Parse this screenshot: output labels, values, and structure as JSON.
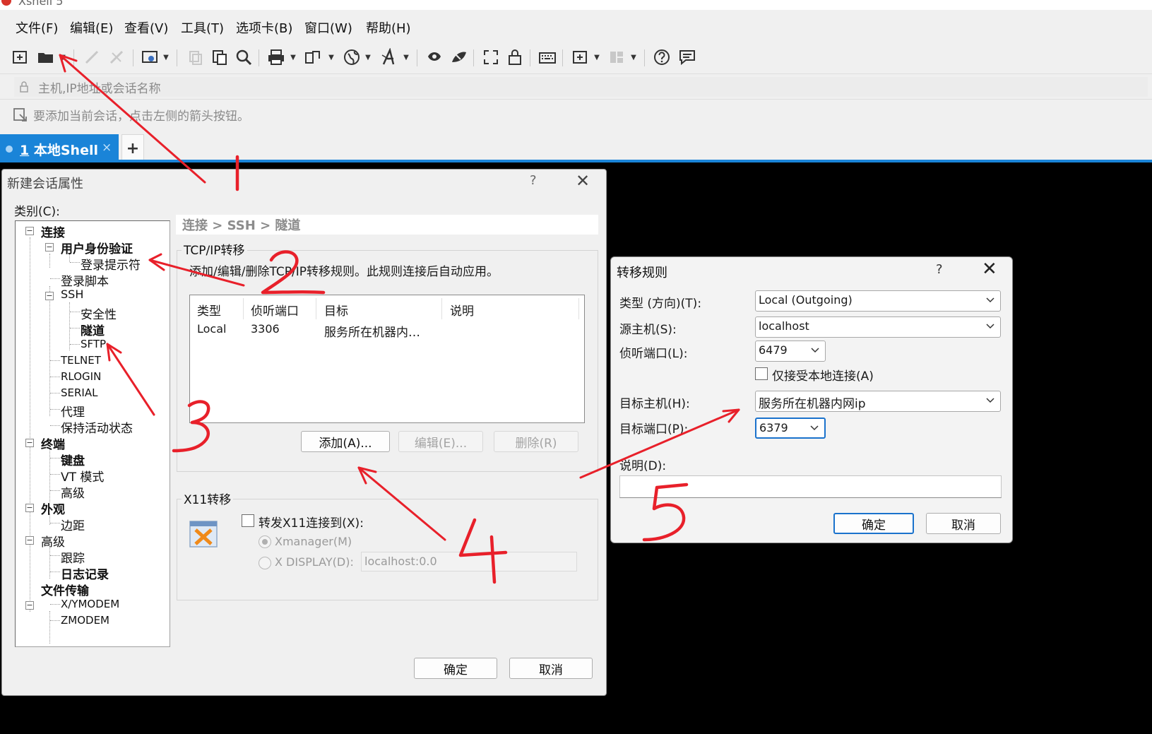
{
  "app": {
    "title": "Xshell 5",
    "menu": [
      "文件(F)",
      "编辑(E)",
      "查看(V)",
      "工具(T)",
      "选项卡(B)",
      "窗口(W)",
      "帮助(H)"
    ],
    "address_placeholder": "主机,IP地址或会话名称",
    "hint_text": "要添加当前会话，点击左侧的箭头按钮。",
    "tab": {
      "index": "1",
      "label": "本地Shell",
      "close": "×",
      "add": "+"
    },
    "accent_color": "#1a84d8"
  },
  "session_dialog": {
    "title": "新建会话属性",
    "help": "?",
    "close": "✕",
    "category_label": "类别(C):",
    "tree": [
      {
        "label": "连接",
        "bold": true
      },
      {
        "label": "用户身份验证",
        "bold": true
      },
      {
        "label": "登录提示符",
        "bold": false
      },
      {
        "label": "登录脚本",
        "bold": false
      },
      {
        "label": "SSH",
        "bold": false
      },
      {
        "label": "安全性",
        "bold": false
      },
      {
        "label": "隧道",
        "bold": true
      },
      {
        "label": "SFTP",
        "bold": false
      },
      {
        "label": "TELNET",
        "bold": false
      },
      {
        "label": "RLOGIN",
        "bold": false
      },
      {
        "label": "SERIAL",
        "bold": false
      },
      {
        "label": "代理",
        "bold": false
      },
      {
        "label": "保持活动状态",
        "bold": false
      },
      {
        "label": "终端",
        "bold": true
      },
      {
        "label": "键盘",
        "bold": true
      },
      {
        "label": "VT 模式",
        "bold": false
      },
      {
        "label": "高级",
        "bold": false
      },
      {
        "label": "外观",
        "bold": true
      },
      {
        "label": "边距",
        "bold": false
      },
      {
        "label": "高级",
        "bold": false
      },
      {
        "label": "跟踪",
        "bold": false
      },
      {
        "label": "日志记录",
        "bold": true
      },
      {
        "label": "文件传输",
        "bold": true
      },
      {
        "label": "X/YMODEM",
        "bold": false
      },
      {
        "label": "ZMODEM",
        "bold": false
      }
    ],
    "breadcrumb": "连接 > SSH > 隧道",
    "tcp_group": {
      "legend": "TCP/IP转移",
      "description": "添加/编辑/删除TCP/IP转移规则。此规则连接后自动应用。",
      "columns": [
        "类型",
        "侦听端口",
        "目标",
        "说明"
      ],
      "rows": [
        {
          "type": "Local",
          "port": "3306",
          "target": "服务所在机器内…",
          "desc": ""
        }
      ],
      "add_button": "添加(A)...",
      "edit_button": "编辑(E)...",
      "delete_button": "删除(R)"
    },
    "x11_group": {
      "legend": "X11转移",
      "forward_label": "转发X11连接到(X):",
      "xmanager_label": "Xmanager(M)",
      "xdisplay_label": "X DISPLAY(D):",
      "xdisplay_value": "localhost:0.0"
    },
    "ok_button": "确定",
    "cancel_button": "取消"
  },
  "rule_dialog": {
    "title": "转移规则",
    "help": "?",
    "close": "✕",
    "type_label": "类型 (方向)(T):",
    "type_value": "Local (Outgoing)",
    "source_label": "源主机(S):",
    "source_value": "localhost",
    "listen_label": "侦听端口(L):",
    "listen_value": "6479",
    "local_only_label": "仅接受本地连接(A)",
    "target_host_label": "目标主机(H):",
    "target_host_value": "服务所在机器内网ip",
    "target_port_label": "目标端口(P):",
    "target_port_value": "6379",
    "desc_label": "说明(D):",
    "desc_value": "",
    "ok_button": "确定",
    "cancel_button": "取消"
  },
  "annotations": {
    "color": "#e8202a",
    "numbers": [
      "1",
      "2",
      "3",
      "4",
      "5"
    ]
  }
}
